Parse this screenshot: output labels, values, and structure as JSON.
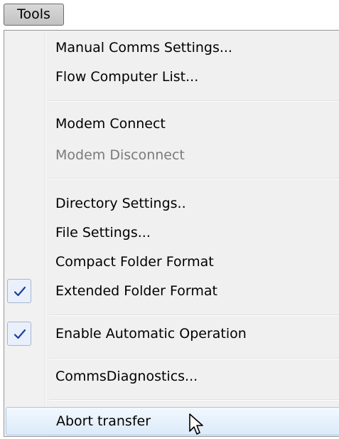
{
  "menubar": {
    "tools_label": "Tools"
  },
  "menu": {
    "items": [
      {
        "label": "Manual Comms Settings...",
        "enabled": true,
        "checked": false
      },
      {
        "label": "Flow Computer List...",
        "enabled": true,
        "checked": false
      },
      {
        "label": "Modem Connect",
        "enabled": true,
        "checked": false
      },
      {
        "label": "Modem Disconnect",
        "enabled": false,
        "checked": false
      },
      {
        "label": "Directory Settings..",
        "enabled": true,
        "checked": false
      },
      {
        "label": "File Settings...",
        "enabled": true,
        "checked": false
      },
      {
        "label": "Compact Folder Format",
        "enabled": true,
        "checked": false
      },
      {
        "label": "Extended Folder Format",
        "enabled": true,
        "checked": true
      },
      {
        "label": "Enable Automatic Operation",
        "enabled": true,
        "checked": true
      },
      {
        "label": "CommsDiagnostics...",
        "enabled": true,
        "checked": false
      },
      {
        "label": "Abort transfer",
        "enabled": true,
        "checked": false,
        "hovered": true
      }
    ]
  },
  "colors": {
    "checkmark": "#1a3f9e",
    "hover_border": "#a8c8e8",
    "disabled_text": "#7a7a7a"
  }
}
